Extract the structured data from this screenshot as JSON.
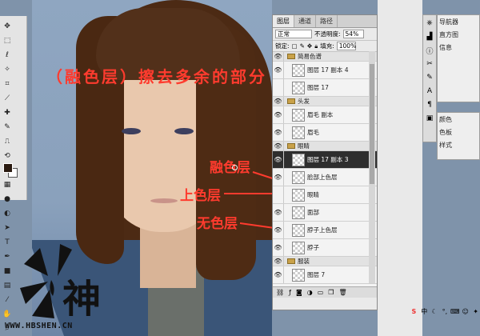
{
  "annotations": {
    "title": "（融色层）擦去多余的部分",
    "blend": "融色层",
    "color": "上色层",
    "none": "无色层"
  },
  "logo": {
    "glyph": "神",
    "url": "WWW.HBSHEN.CN"
  },
  "layers_panel": {
    "tabs": [
      "图层",
      "通道",
      "路径"
    ],
    "blend_mode": "正常",
    "opacity_label": "不透明度:",
    "opacity_value": "54%",
    "lock_label": "锁定:",
    "fill_label": "填充:",
    "fill_value": "100%",
    "rows": [
      {
        "type": "group",
        "name": "简易色谱",
        "visible": true
      },
      {
        "type": "layer",
        "name": "图层 17 副本 4",
        "visible": true
      },
      {
        "type": "layer",
        "name": "图层 17",
        "visible": false
      },
      {
        "type": "group",
        "name": "头发",
        "visible": true
      },
      {
        "type": "layer",
        "name": "眉毛 副本",
        "visible": true
      },
      {
        "type": "layer",
        "name": "眉毛",
        "visible": true
      },
      {
        "type": "group",
        "name": "眼睛",
        "visible": true
      },
      {
        "type": "layer",
        "name": "图层 17 副本 3",
        "visible": true,
        "selected": true
      },
      {
        "type": "layer",
        "name": "脸部上色层",
        "visible": true
      },
      {
        "type": "layer",
        "name": "眼睛",
        "visible": false
      },
      {
        "type": "layer",
        "name": "面部",
        "visible": true
      },
      {
        "type": "layer",
        "name": "脖子上色层",
        "visible": true
      },
      {
        "type": "layer",
        "name": "脖子",
        "visible": true
      },
      {
        "type": "group",
        "name": "服装",
        "visible": true
      },
      {
        "type": "layer",
        "name": "图层 7",
        "visible": true
      }
    ]
  },
  "right_panels": {
    "nav_items": [
      "导航器",
      "直方图",
      "信息"
    ],
    "color_items": [
      "颜色",
      "色板",
      "样式"
    ]
  },
  "taskbar": {
    "label": "中"
  }
}
